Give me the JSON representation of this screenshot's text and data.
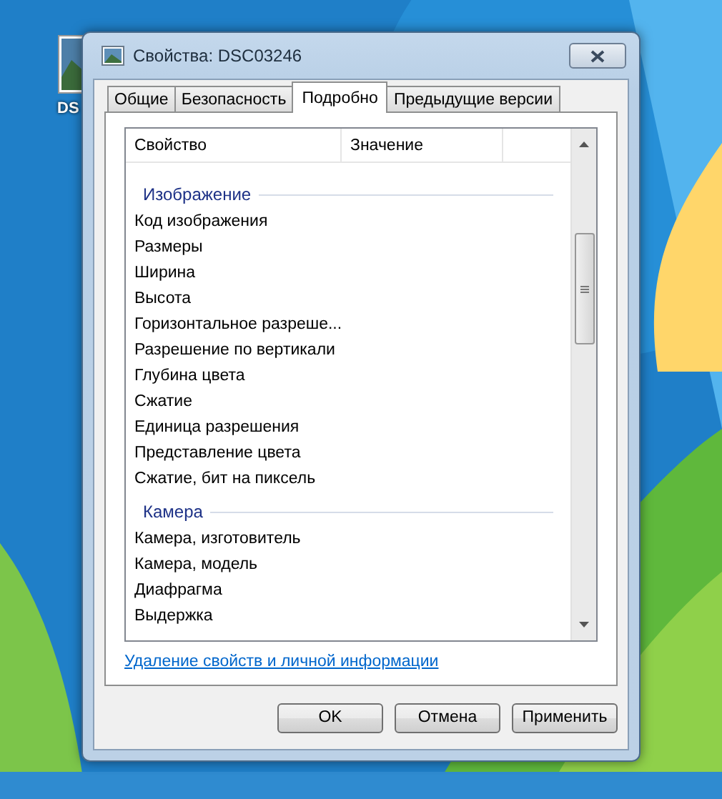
{
  "desktop": {
    "icons": [
      {
        "label": "DS"
      }
    ]
  },
  "window": {
    "title": "Свойства: DSC03246"
  },
  "tabs": [
    {
      "label": "Общие",
      "selected": false
    },
    {
      "label": "Безопасность",
      "selected": false
    },
    {
      "label": "Подробно",
      "selected": true
    },
    {
      "label": "Предыдущие версии",
      "selected": false
    }
  ],
  "list": {
    "columns": [
      "Свойство",
      "Значение"
    ],
    "groups": [
      {
        "title": "Изображение",
        "items": [
          "Код изображения",
          "Размеры",
          "Ширина",
          "Высота",
          "Горизонтальное разреше...",
          "Разрешение по вертикали",
          "Глубина цвета",
          "Сжатие",
          "Единица разрешения",
          "Представление цвета",
          "Сжатие, бит на пиксель"
        ]
      },
      {
        "title": "Камера",
        "items": [
          "Камера, изготовитель",
          "Камера, модель",
          "Диафрагма",
          "Выдержка"
        ]
      }
    ]
  },
  "link": "Удаление свойств и личной информации",
  "buttons": [
    "OK",
    "Отмена",
    "Применить"
  ]
}
